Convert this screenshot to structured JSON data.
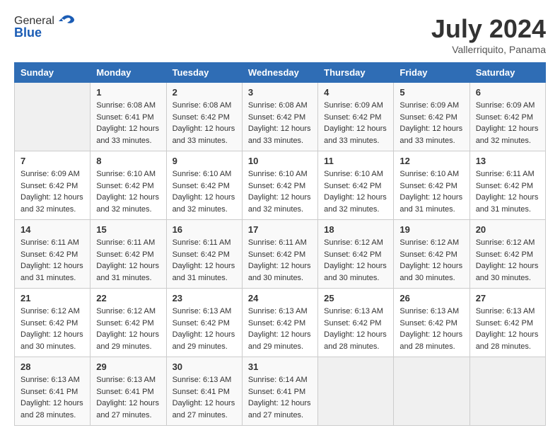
{
  "header": {
    "logo_general": "General",
    "logo_blue": "Blue",
    "month_title": "July 2024",
    "location": "Vallerriquito, Panama"
  },
  "calendar": {
    "days_of_week": [
      "Sunday",
      "Monday",
      "Tuesday",
      "Wednesday",
      "Thursday",
      "Friday",
      "Saturday"
    ],
    "weeks": [
      [
        {
          "day": "",
          "sunrise": "",
          "sunset": "",
          "daylight": ""
        },
        {
          "day": "1",
          "sunrise": "6:08 AM",
          "sunset": "6:41 PM",
          "daylight": "12 hours and 33 minutes."
        },
        {
          "day": "2",
          "sunrise": "6:08 AM",
          "sunset": "6:42 PM",
          "daylight": "12 hours and 33 minutes."
        },
        {
          "day": "3",
          "sunrise": "6:08 AM",
          "sunset": "6:42 PM",
          "daylight": "12 hours and 33 minutes."
        },
        {
          "day": "4",
          "sunrise": "6:09 AM",
          "sunset": "6:42 PM",
          "daylight": "12 hours and 33 minutes."
        },
        {
          "day": "5",
          "sunrise": "6:09 AM",
          "sunset": "6:42 PM",
          "daylight": "12 hours and 33 minutes."
        },
        {
          "day": "6",
          "sunrise": "6:09 AM",
          "sunset": "6:42 PM",
          "daylight": "12 hours and 32 minutes."
        }
      ],
      [
        {
          "day": "7",
          "sunrise": "6:09 AM",
          "sunset": "6:42 PM",
          "daylight": "12 hours and 32 minutes."
        },
        {
          "day": "8",
          "sunrise": "6:10 AM",
          "sunset": "6:42 PM",
          "daylight": "12 hours and 32 minutes."
        },
        {
          "day": "9",
          "sunrise": "6:10 AM",
          "sunset": "6:42 PM",
          "daylight": "12 hours and 32 minutes."
        },
        {
          "day": "10",
          "sunrise": "6:10 AM",
          "sunset": "6:42 PM",
          "daylight": "12 hours and 32 minutes."
        },
        {
          "day": "11",
          "sunrise": "6:10 AM",
          "sunset": "6:42 PM",
          "daylight": "12 hours and 32 minutes."
        },
        {
          "day": "12",
          "sunrise": "6:10 AM",
          "sunset": "6:42 PM",
          "daylight": "12 hours and 31 minutes."
        },
        {
          "day": "13",
          "sunrise": "6:11 AM",
          "sunset": "6:42 PM",
          "daylight": "12 hours and 31 minutes."
        }
      ],
      [
        {
          "day": "14",
          "sunrise": "6:11 AM",
          "sunset": "6:42 PM",
          "daylight": "12 hours and 31 minutes."
        },
        {
          "day": "15",
          "sunrise": "6:11 AM",
          "sunset": "6:42 PM",
          "daylight": "12 hours and 31 minutes."
        },
        {
          "day": "16",
          "sunrise": "6:11 AM",
          "sunset": "6:42 PM",
          "daylight": "12 hours and 31 minutes."
        },
        {
          "day": "17",
          "sunrise": "6:11 AM",
          "sunset": "6:42 PM",
          "daylight": "12 hours and 30 minutes."
        },
        {
          "day": "18",
          "sunrise": "6:12 AM",
          "sunset": "6:42 PM",
          "daylight": "12 hours and 30 minutes."
        },
        {
          "day": "19",
          "sunrise": "6:12 AM",
          "sunset": "6:42 PM",
          "daylight": "12 hours and 30 minutes."
        },
        {
          "day": "20",
          "sunrise": "6:12 AM",
          "sunset": "6:42 PM",
          "daylight": "12 hours and 30 minutes."
        }
      ],
      [
        {
          "day": "21",
          "sunrise": "6:12 AM",
          "sunset": "6:42 PM",
          "daylight": "12 hours and 30 minutes."
        },
        {
          "day": "22",
          "sunrise": "6:12 AM",
          "sunset": "6:42 PM",
          "daylight": "12 hours and 29 minutes."
        },
        {
          "day": "23",
          "sunrise": "6:13 AM",
          "sunset": "6:42 PM",
          "daylight": "12 hours and 29 minutes."
        },
        {
          "day": "24",
          "sunrise": "6:13 AM",
          "sunset": "6:42 PM",
          "daylight": "12 hours and 29 minutes."
        },
        {
          "day": "25",
          "sunrise": "6:13 AM",
          "sunset": "6:42 PM",
          "daylight": "12 hours and 28 minutes."
        },
        {
          "day": "26",
          "sunrise": "6:13 AM",
          "sunset": "6:42 PM",
          "daylight": "12 hours and 28 minutes."
        },
        {
          "day": "27",
          "sunrise": "6:13 AM",
          "sunset": "6:42 PM",
          "daylight": "12 hours and 28 minutes."
        }
      ],
      [
        {
          "day": "28",
          "sunrise": "6:13 AM",
          "sunset": "6:41 PM",
          "daylight": "12 hours and 28 minutes."
        },
        {
          "day": "29",
          "sunrise": "6:13 AM",
          "sunset": "6:41 PM",
          "daylight": "12 hours and 27 minutes."
        },
        {
          "day": "30",
          "sunrise": "6:13 AM",
          "sunset": "6:41 PM",
          "daylight": "12 hours and 27 minutes."
        },
        {
          "day": "31",
          "sunrise": "6:14 AM",
          "sunset": "6:41 PM",
          "daylight": "12 hours and 27 minutes."
        },
        {
          "day": "",
          "sunrise": "",
          "sunset": "",
          "daylight": ""
        },
        {
          "day": "",
          "sunrise": "",
          "sunset": "",
          "daylight": ""
        },
        {
          "day": "",
          "sunrise": "",
          "sunset": "",
          "daylight": ""
        }
      ]
    ]
  }
}
